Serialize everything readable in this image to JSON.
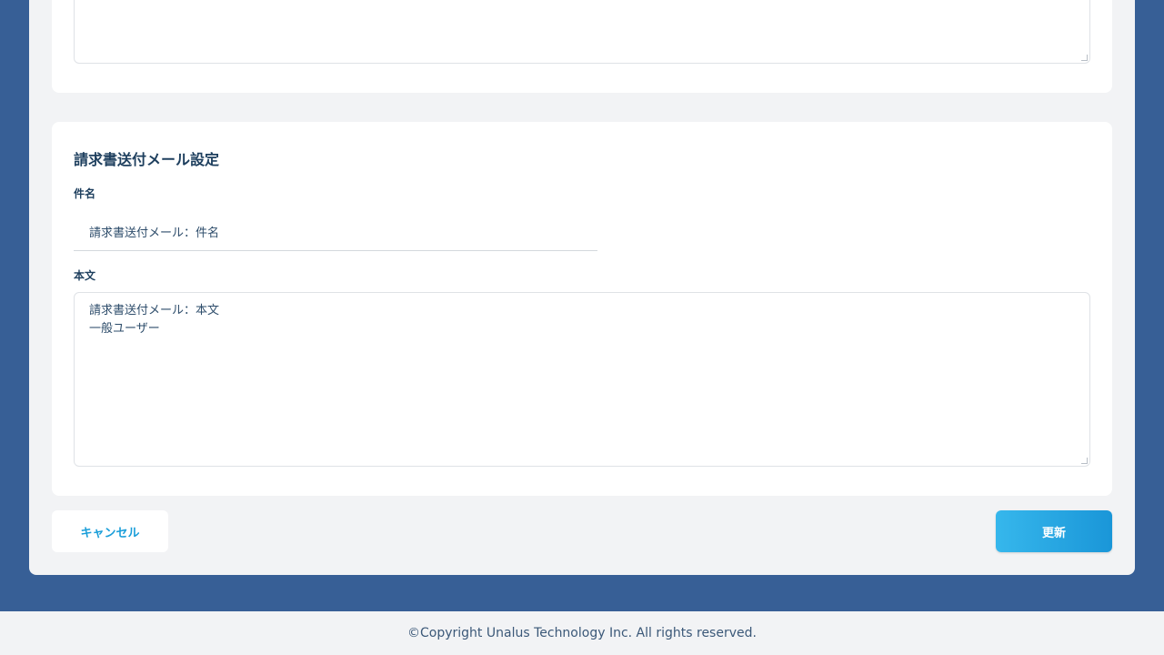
{
  "invoice_mail": {
    "title": "請求書送付メール設定",
    "subject_label": "件名",
    "subject_value": "請求書送付メール：件名",
    "body_label": "本文",
    "body_lines": [
      "請求書送付メール：本文",
      "一般ユーザー"
    ]
  },
  "actions": {
    "cancel_label": "キャンセル",
    "update_label": "更新"
  },
  "footer": {
    "copyright": "©Copyright Unalus Technology Inc. All rights reserved."
  },
  "colors": {
    "background": "#375f96",
    "accent": "#1a9ed9"
  }
}
